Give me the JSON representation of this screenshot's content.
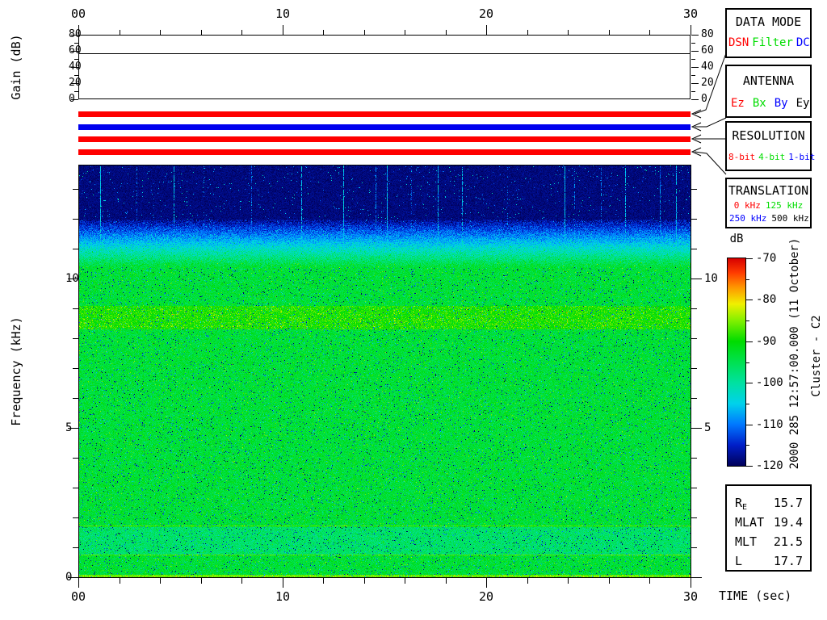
{
  "gain_plot": {
    "ylabel": "Gain (dB)",
    "y_tick_values": [
      0,
      20,
      40,
      60,
      80
    ],
    "y_tick_labels": [
      "0",
      "20",
      "40",
      "60",
      "80"
    ],
    "y_range": [
      0,
      80
    ],
    "gain_line_db": 57,
    "x_tick_values": [
      0,
      10,
      20,
      30
    ],
    "x_tick_labels": [
      "00",
      "10",
      "20",
      "30"
    ]
  },
  "status_bars": [
    {
      "meaning": "data-mode-selected",
      "selected": "DSN",
      "color": "#ff0000"
    },
    {
      "meaning": "antenna-selected",
      "selected": "By",
      "color": "#0000ee"
    },
    {
      "meaning": "resolution-selected",
      "selected": "8-bit",
      "color": "#ff0000"
    },
    {
      "meaning": "translation-selected",
      "selected": "0 kHz",
      "color": "#ff0000"
    }
  ],
  "panels": [
    {
      "title": "DATA MODE",
      "options": [
        {
          "label": "DSN",
          "color": "#ff0000"
        },
        {
          "label": "Filter",
          "color": "#00dd00"
        },
        {
          "label": "DC",
          "color": "#0000ff"
        }
      ]
    },
    {
      "title": "ANTENNA",
      "options": [
        {
          "label": "Ez",
          "color": "#ff0000"
        },
        {
          "label": "Bx",
          "color": "#00dd00"
        },
        {
          "label": "By",
          "color": "#0000ff"
        },
        {
          "label": "Ey",
          "color": "#000000"
        }
      ]
    },
    {
      "title": "RESOLUTION",
      "options": [
        {
          "label": "8-bit",
          "color": "#ff0000"
        },
        {
          "label": "4-bit",
          "color": "#00dd00"
        },
        {
          "label": "1-bit",
          "color": "#0000ff"
        }
      ]
    },
    {
      "title": "TRANSLATION",
      "options": [
        {
          "label": "0 kHz",
          "color": "#ff0000"
        },
        {
          "label": "125 kHz",
          "color": "#00dd00"
        },
        {
          "label": "250 kHz",
          "color": "#0000ff"
        },
        {
          "label": "500 kHz",
          "color": "#000000"
        }
      ]
    }
  ],
  "colorbar": {
    "unit": "dB",
    "tick_values": [
      -70,
      -80,
      -90,
      -100,
      -110,
      -120
    ],
    "tick_labels": [
      "-70",
      "-80",
      "-90",
      "-100",
      "-110",
      "-120"
    ],
    "minor_step_db": 5
  },
  "side_text": {
    "datetime": "2000 285 12:57:00.000 (11 October)",
    "spacecraft": "Cluster - C2"
  },
  "info_box": {
    "rows": [
      {
        "label": "R",
        "sub": "E",
        "value": "15.7"
      },
      {
        "label": "MLAT",
        "sub": "",
        "value": "19.4"
      },
      {
        "label": "MLT",
        "sub": "",
        "value": "21.5"
      },
      {
        "label": "L",
        "sub": "",
        "value": "17.7"
      }
    ]
  },
  "time_axis": {
    "label": "TIME (sec)",
    "tick_values": [
      0,
      10,
      20,
      30
    ],
    "tick_labels": [
      "00",
      "10",
      "20",
      "30"
    ],
    "minor_step_sec": 2
  },
  "freq_axis": {
    "label": "Frequency (kHz)",
    "tick_values": [
      0,
      5,
      10
    ],
    "tick_labels": [
      "0",
      "5",
      "10"
    ],
    "right_tick_values": [
      5,
      10
    ],
    "right_tick_labels": [
      "5",
      "10"
    ],
    "minor_step_khz": 1
  },
  "chart_data": {
    "type": "heatmap",
    "title": "",
    "xlabel": "TIME (sec)",
    "ylabel": "Frequency (kHz)",
    "x_range_sec": [
      0,
      30
    ],
    "y_range_khz": [
      0,
      13.8
    ],
    "intensity_range_db": [
      -120,
      -70
    ],
    "background_level_db": -93.5,
    "noise_floor_cutoff_khz": 12.0,
    "signal_top_khz": 10.4,
    "enhanced_band": {
      "f_low_khz": 8.3,
      "f_high_khz": 9.1,
      "boost_db": 4
    },
    "quiet_band": {
      "f_low_khz": 0.78,
      "f_high_khz": 1.7,
      "drop_db": 3
    },
    "narrowband_lines_khz": [
      0.76,
      1.72
    ],
    "bottom_edge_level_db": -86,
    "gain_line_db": 57,
    "impulse_streaks_sec": [
      {
        "t": 1.05,
        "s": 1
      },
      {
        "t": 2.8,
        "s": 0.45
      },
      {
        "t": 4.65,
        "s": 0.8
      },
      {
        "t": 6.1,
        "s": 0.3
      },
      {
        "t": 8.45,
        "s": 0.5
      },
      {
        "t": 10.9,
        "s": 0.8
      },
      {
        "t": 12.95,
        "s": 1
      },
      {
        "t": 14.55,
        "s": 0.7
      },
      {
        "t": 15.1,
        "s": 1
      },
      {
        "t": 16.3,
        "s": 0.35
      },
      {
        "t": 17.6,
        "s": 0.9
      },
      {
        "t": 18.8,
        "s": 0.75
      },
      {
        "t": 21.0,
        "s": 0.3
      },
      {
        "t": 23.8,
        "s": 1
      },
      {
        "t": 24.3,
        "s": 0.5
      },
      {
        "t": 25.6,
        "s": 0.4
      },
      {
        "t": 26.8,
        "s": 0.8
      },
      {
        "t": 28.5,
        "s": 0.6
      },
      {
        "t": 29.3,
        "s": 0.9
      }
    ],
    "colormap_stops": [
      [
        0.0,
        "#00005a"
      ],
      [
        0.1,
        "#001ec8"
      ],
      [
        0.2,
        "#0078ff"
      ],
      [
        0.3,
        "#00d2eb"
      ],
      [
        0.4,
        "#00e1a0"
      ],
      [
        0.5,
        "#00e150"
      ],
      [
        0.6,
        "#00dc00"
      ],
      [
        0.7,
        "#82f000"
      ],
      [
        0.78,
        "#f0f000"
      ],
      [
        0.86,
        "#ff9600"
      ],
      [
        0.93,
        "#ff3c00"
      ],
      [
        1.0,
        "#d70000"
      ]
    ],
    "legend_position": "right",
    "grid": false
  }
}
